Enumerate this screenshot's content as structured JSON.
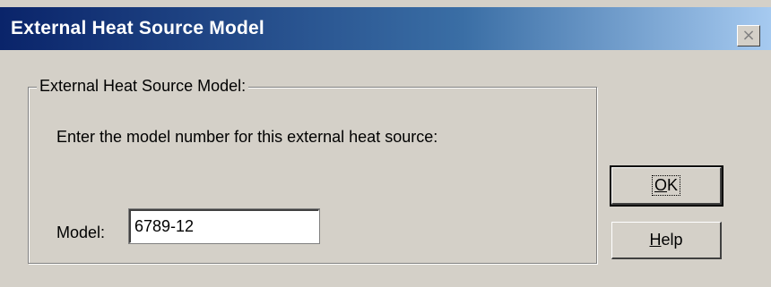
{
  "window": {
    "title": "External Heat Source Model",
    "close_label": "×"
  },
  "group": {
    "legend": "External Heat Source Model:",
    "prompt": "Enter the model number for this external heat source:",
    "model_label": "Model:",
    "model_value": "6789-12"
  },
  "buttons": {
    "ok_mnemonic": "O",
    "ok_rest": "K",
    "help_mnemonic": "H",
    "help_rest": "elp"
  },
  "colors": {
    "face": "#d4d0c8",
    "title_start": "#0a246a",
    "title_end": "#a6caf0"
  }
}
